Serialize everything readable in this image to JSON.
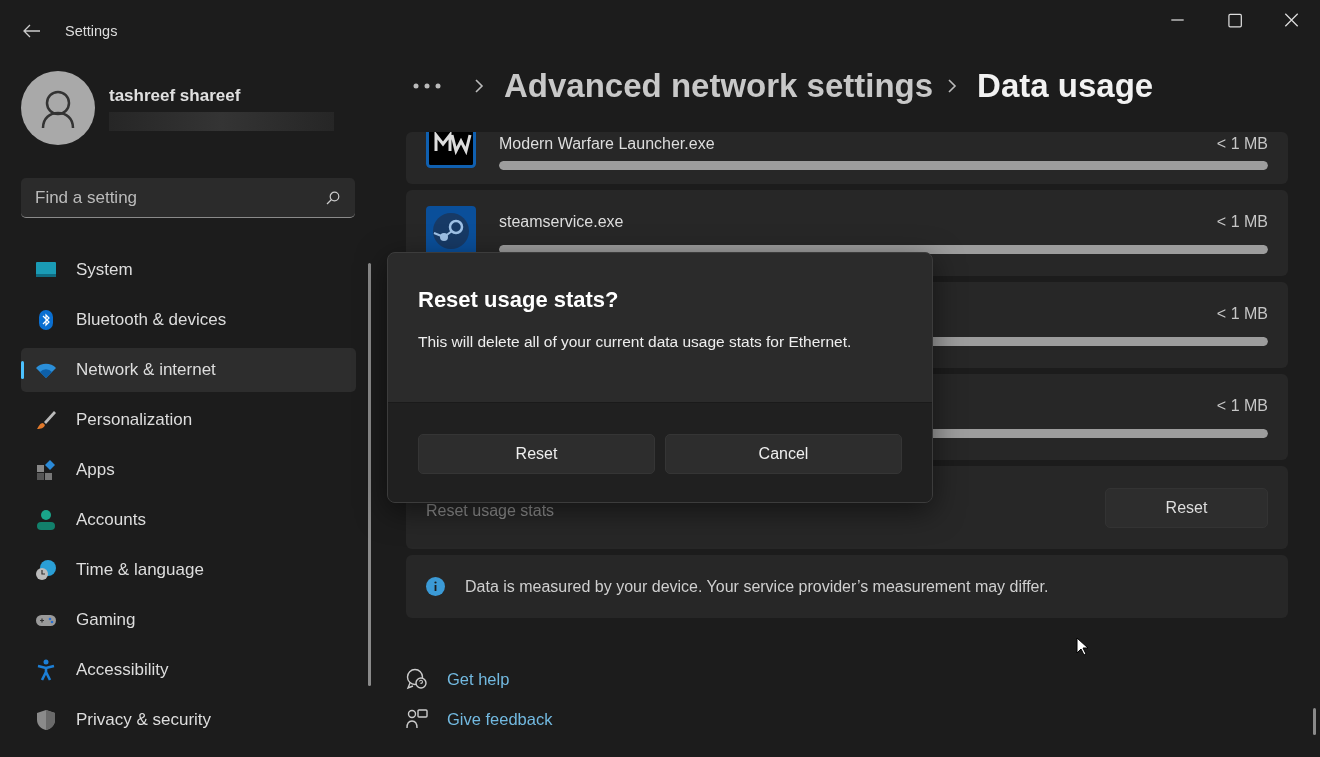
{
  "window": {
    "title": "Settings"
  },
  "user": {
    "name": "tashreef shareef"
  },
  "search": {
    "placeholder": "Find a setting"
  },
  "sidebar": {
    "items": [
      {
        "label": "System",
        "kind": "system",
        "selected": false
      },
      {
        "label": "Bluetooth & devices",
        "kind": "bluetooth",
        "selected": false
      },
      {
        "label": "Network & internet",
        "kind": "network",
        "selected": true
      },
      {
        "label": "Personalization",
        "kind": "brush",
        "selected": false
      },
      {
        "label": "Apps",
        "kind": "apps",
        "selected": false
      },
      {
        "label": "Accounts",
        "kind": "accounts",
        "selected": false
      },
      {
        "label": "Time & language",
        "kind": "time",
        "selected": false
      },
      {
        "label": "Gaming",
        "kind": "gaming",
        "selected": false
      },
      {
        "label": "Accessibility",
        "kind": "accessibility",
        "selected": false
      },
      {
        "label": "Privacy & security",
        "kind": "privacy",
        "selected": false
      }
    ]
  },
  "breadcrumb": [
    "Advanced network settings",
    "Data usage"
  ],
  "apps": [
    {
      "name": "Modern Warfare Launcher.exe",
      "usage": "< 1 MB",
      "level": 1,
      "kind": "mw"
    },
    {
      "name": "steamservice.exe",
      "usage": "< 1 MB",
      "level": 1,
      "kind": "steam"
    },
    {
      "usage": "< 1 MB",
      "level": 1
    },
    {
      "usage": "< 1 MB",
      "level": 1
    }
  ],
  "reset_card": {
    "label": "Reset usage stats",
    "button": "Reset"
  },
  "info": {
    "text": "Data is measured by your device. Your service provider’s measurement may differ."
  },
  "links": [
    {
      "label": "Get help",
      "kind": "help"
    },
    {
      "label": "Give feedback",
      "kind": "feedback"
    }
  ],
  "dialog": {
    "title": "Reset usage stats?",
    "message": "This will delete all of your current data usage stats for Ethernet.",
    "buttons": [
      "Reset",
      "Cancel"
    ]
  }
}
